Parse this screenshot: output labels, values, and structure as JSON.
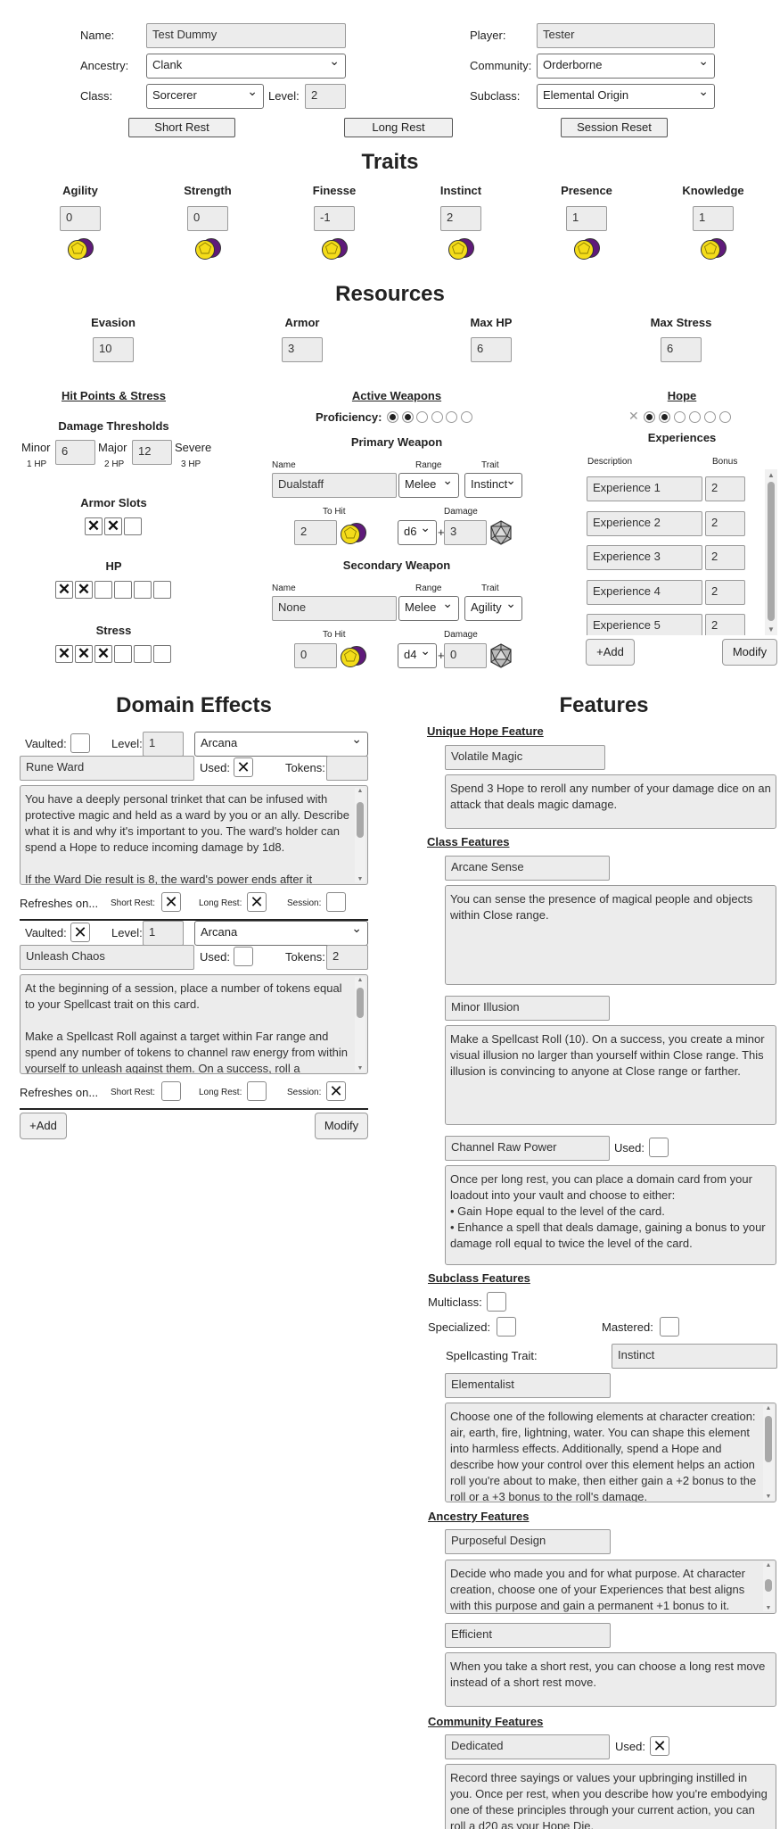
{
  "header": {
    "name_label": "Name:",
    "name": "Test Dummy",
    "player_label": "Player:",
    "player": "Tester",
    "ancestry_label": "Ancestry:",
    "ancestry": "Clank",
    "community_label": "Community:",
    "community": "Orderborne",
    "class_label": "Class:",
    "class": "Sorcerer",
    "level_label": "Level:",
    "level": "2",
    "subclass_label": "Subclass:",
    "subclass": "Elemental Origin",
    "short_rest": "Short Rest",
    "long_rest": "Long Rest",
    "session_reset": "Session Reset"
  },
  "traits": {
    "title": "Traits",
    "items": [
      {
        "name": "Agility",
        "value": "0"
      },
      {
        "name": "Strength",
        "value": "0"
      },
      {
        "name": "Finesse",
        "value": "-1"
      },
      {
        "name": "Instinct",
        "value": "2"
      },
      {
        "name": "Presence",
        "value": "1"
      },
      {
        "name": "Knowledge",
        "value": "1"
      }
    ]
  },
  "resources": {
    "title": "Resources",
    "items": [
      {
        "name": "Evasion",
        "value": "10"
      },
      {
        "name": "Armor",
        "value": "3"
      },
      {
        "name": "Max HP",
        "value": "6"
      },
      {
        "name": "Max Stress",
        "value": "6"
      }
    ]
  },
  "hp_stress": {
    "title": "Hit Points & Stress",
    "thresholds_title": "Damage Thresholds",
    "minor": "Minor",
    "minor_sub": "1 HP",
    "minor_value": "6",
    "major": "Major",
    "major_sub": "2 HP",
    "major_value": "12",
    "severe": "Severe",
    "severe_sub": "3 HP",
    "armor_slots": "Armor Slots",
    "armor_marked": 2,
    "armor_total": 3,
    "hp": "HP",
    "hp_marked": 2,
    "hp_total": 6,
    "stress": "Stress",
    "stress_marked": 3,
    "stress_total": 6
  },
  "weapons": {
    "title": "Active Weapons",
    "proficiency": "Proficiency:",
    "proficiency_value": 2,
    "proficiency_max": 6,
    "primary_title": "Primary Weapon",
    "name_col": "Name",
    "range_col": "Range",
    "trait_col": "Trait",
    "to_hit": "To Hit",
    "damage": "Damage",
    "plus": "+",
    "primary": {
      "name": "Dualstaff",
      "range": "Melee",
      "trait": "Instinct",
      "to_hit": "2",
      "die": "d6",
      "bonus": "3"
    },
    "secondary_title": "Secondary Weapon",
    "secondary": {
      "name": "None",
      "range": "Melee",
      "trait": "Agility",
      "to_hit": "0",
      "die": "d4",
      "bonus": "0"
    }
  },
  "hope": {
    "title": "Hope",
    "value": 2,
    "max": 6,
    "experiences_title": "Experiences",
    "desc_col": "Description",
    "bonus_col": "Bonus",
    "experiences": [
      {
        "name": "Experience 1",
        "bonus": "2"
      },
      {
        "name": "Experience 2",
        "bonus": "2"
      },
      {
        "name": "Experience 3",
        "bonus": "2"
      },
      {
        "name": "Experience 4",
        "bonus": "2"
      },
      {
        "name": "Experience 5",
        "bonus": "2"
      }
    ],
    "add": "+Add",
    "modify": "Modify"
  },
  "domain": {
    "title": "Domain Effects",
    "vaulted": "Vaulted:",
    "level": "Level:",
    "used": "Used:",
    "tokens": "Tokens:",
    "refreshes": "Refreshes on...",
    "short_rest": "Short Rest:",
    "long_rest": "Long Rest:",
    "session": "Session:",
    "add": "+Add",
    "modify": "Modify",
    "cards": [
      {
        "vaulted": false,
        "level": "1",
        "domain": "Arcana",
        "name": "Rune Ward",
        "used": true,
        "tokens": "",
        "text": "You have a deeply personal trinket that can be infused with protective magic and held as a ward by you or an ally. Describe what it is and why it's important to you. The ward's holder can spend a Hope to reduce incoming damage by 1d8.\n\nIf the Ward Die result is 8, the ward's power ends after it",
        "short": true,
        "long": true,
        "session": false
      },
      {
        "vaulted": true,
        "level": "1",
        "domain": "Arcana",
        "name": "Unleash Chaos",
        "used": false,
        "tokens": "2",
        "text": "At the beginning of a session, place a number of tokens equal to your Spellcast trait on this card.\n\nMake a Spellcast Roll against a target within Far range and spend any number of tokens to channel raw energy from within yourself to unleash against them. On a success, roll a",
        "short": false,
        "long": false,
        "session": true
      }
    ]
  },
  "features": {
    "title": "Features",
    "unique_title": "Unique Hope Feature",
    "unique": {
      "name": "Volatile Magic",
      "text": "Spend 3 Hope to reroll any number of your damage dice on an attack that deals magic damage."
    },
    "class_title": "Class Features",
    "class_items": [
      {
        "name": "Arcane Sense",
        "text": "You can sense the presence of magical people and objects within Close range."
      },
      {
        "name": "Minor Illusion",
        "text": "Make a Spellcast Roll (10). On a success, you create a minor visual illusion no larger than yourself within Close range. This illusion is convincing to anyone at Close range or farther."
      },
      {
        "name": "Channel Raw Power",
        "used_label": "Used:",
        "text": "Once per long rest, you can place a domain card from your loadout into your vault and choose to either:\n• Gain Hope equal to the level of the card.\n• Enhance a spell that deals damage, gaining a bonus to your damage roll equal to twice the level of the card."
      }
    ],
    "subclass_title": "Subclass Features",
    "multiclass": "Multiclass:",
    "specialized": "Specialized:",
    "mastered": "Mastered:",
    "spell_trait_label": "Spellcasting Trait:",
    "spell_trait": "Instinct",
    "subclass_item": {
      "name": "Elementalist",
      "text": "Choose one of the following elements at character creation: air, earth, fire, lightning, water. You can shape this element into harmless effects. Additionally, spend a Hope and describe how your control over this element helps an action roll you're about to make, then either gain a +2 bonus to the roll or a +3 bonus to the roll's damage."
    },
    "ancestry_title": "Ancestry Features",
    "ancestry_items": [
      {
        "name": "Purposeful Design",
        "text": "Decide who made you and for what purpose. At character creation, choose one of your Experiences that best aligns with this purpose and gain a permanent +1 bonus to it."
      },
      {
        "name": "Efficient",
        "text": "When you take a short rest, you can choose a long rest move instead of a short rest move."
      }
    ],
    "community_title": "Community Features",
    "community_item": {
      "name": "Dedicated",
      "used_label": "Used:",
      "text": "Record three sayings or values your upbringing instilled in you. Once per rest, when you describe how you're embodying one of these principles through your current action, you can roll a d20 as your Hope Die."
    }
  },
  "colors": {
    "die_yellow": "#f4dc1a",
    "die_purple": "#5f1a7a"
  }
}
